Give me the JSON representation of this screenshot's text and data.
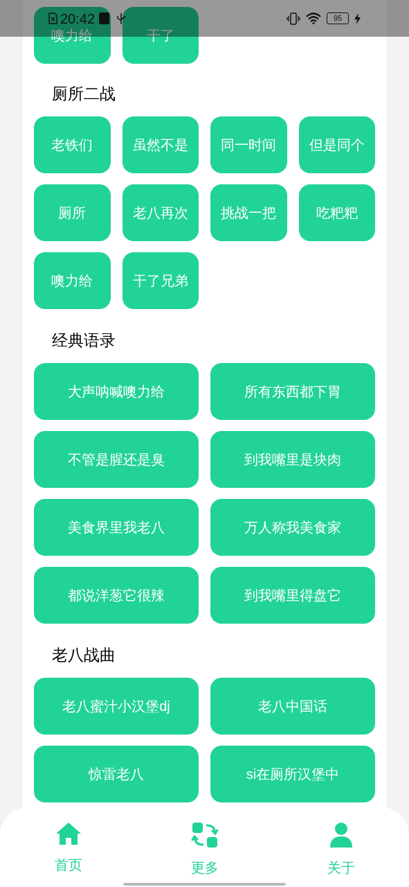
{
  "status_bar": {
    "time": "20:42",
    "battery": "95"
  },
  "sections": [
    {
      "kind": "short",
      "buttons": [
        "噢力给",
        "干了"
      ]
    },
    {
      "title": "厕所二战",
      "kind": "short",
      "buttons": [
        "老铁们",
        "虽然不是",
        "同一时间",
        "但是同个",
        "厕所",
        "老八再次",
        "挑战一把",
        "吃粑粑",
        "噢力给",
        "干了兄弟"
      ]
    },
    {
      "title": "经典语录",
      "kind": "long",
      "buttons": [
        "大声呐喊噢力给",
        "所有东西都下胃",
        "不管是腥还是臭",
        "到我嘴里是块肉",
        "美食界里我老八",
        "万人称我美食家",
        "都说洋葱它很辣",
        "到我嘴里得盘它"
      ]
    },
    {
      "title": "老八战曲",
      "kind": "long",
      "buttons": [
        "老八蜜汁小汉堡dj",
        "老八中国话",
        "惊雷老八",
        "si在厕所汉堡中"
      ]
    }
  ],
  "nav": [
    {
      "kind": "home",
      "label": "首页"
    },
    {
      "kind": "more",
      "label": "更多"
    },
    {
      "kind": "about",
      "label": "关于"
    }
  ]
}
